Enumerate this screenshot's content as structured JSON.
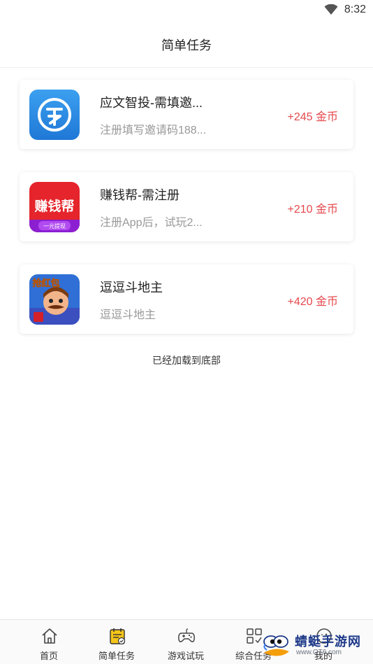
{
  "status_bar": {
    "time": "8:32",
    "wifi_icon": "wifi-icon"
  },
  "header": {
    "title": "简单任务"
  },
  "tasks": [
    {
      "name": "应文智投-需填邀...",
      "desc": "注册填写邀请码188...",
      "reward": "+245 金币",
      "icon": "yingwen-app-icon",
      "color": "#2f8ee6"
    },
    {
      "name": "赚钱帮-需注册",
      "desc": "注册App后，试玩2...",
      "reward": "+210 金币",
      "icon": "zhuanqianbang-app-icon",
      "color": "#e5242b",
      "icon_text": "赚钱帮",
      "icon_sub": "一元提现"
    },
    {
      "name": "逗逗斗地主",
      "desc": "逗逗斗地主",
      "reward": "+420 金币",
      "icon": "doudou-app-icon",
      "color": "#2563eb",
      "icon_text": "抢红包"
    }
  ],
  "list_end_text": "已经加载到底部",
  "tab_bar": {
    "items": [
      {
        "label": "首页",
        "icon": "home-icon"
      },
      {
        "label": "简单任务",
        "icon": "simple-task-icon",
        "active": true
      },
      {
        "label": "游戏试玩",
        "icon": "gamepad-icon"
      },
      {
        "label": "综合任务",
        "icon": "grid-task-icon"
      },
      {
        "label": "我的",
        "icon": "profile-icon"
      }
    ]
  },
  "watermark": {
    "text": "蜻蜓手游网",
    "url": "www.QT6.com",
    "icon": "dragonfly-logo"
  },
  "colors": {
    "reward": "#e5484d",
    "active_tab": "#f5c518"
  }
}
